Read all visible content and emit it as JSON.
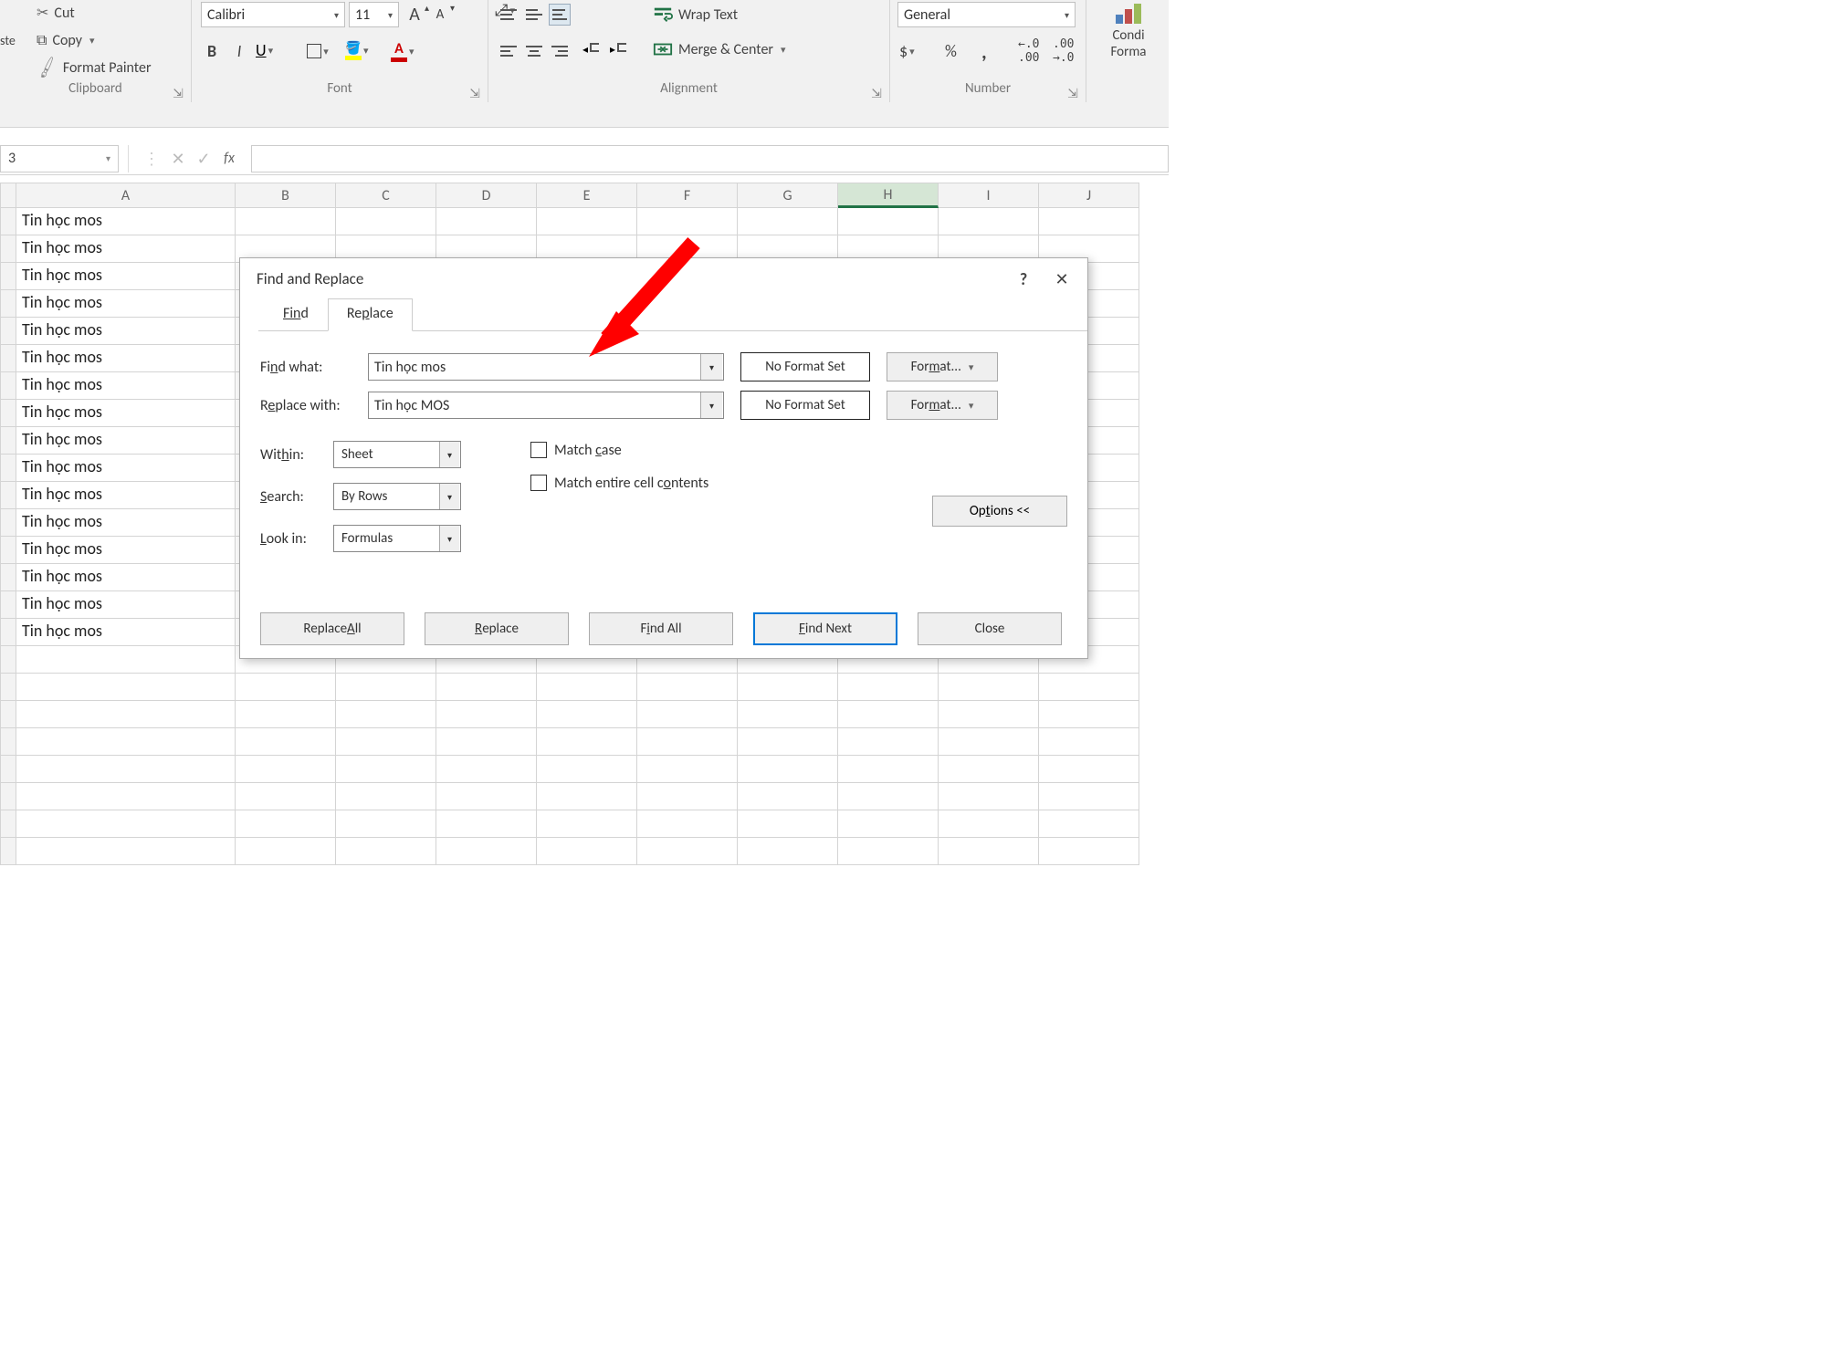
{
  "ribbon": {
    "clipboard": {
      "label": "Clipboard",
      "paste": "ste",
      "cut": "Cut",
      "copy": "Copy",
      "format_painter": "Format Painter"
    },
    "font": {
      "label": "Font",
      "name": "Calibri",
      "size": "11",
      "bold": "B",
      "italic": "I",
      "underline": "U",
      "increase_font": "A",
      "decrease_font": "A",
      "fill_letter": "A",
      "color_letter": "A"
    },
    "alignment": {
      "label": "Alignment",
      "wrap": "Wrap Text",
      "merge": "Merge & Center"
    },
    "number": {
      "label": "Number",
      "format": "General",
      "accounting": "$",
      "percent": "%",
      "comma": ",",
      "inc_dec": "←.0\n.00",
      "dec_dec": ".00\n→.0"
    },
    "cond": {
      "label1": "Condi",
      "label2": "Forma"
    }
  },
  "formula_bar": {
    "name_box": "3",
    "fx": "fx"
  },
  "columns": [
    "A",
    "B",
    "C",
    "D",
    "E",
    "F",
    "G",
    "H",
    "I",
    "J"
  ],
  "active_column_index": 7,
  "cell_value": "Tin học mos",
  "data_rows": 16,
  "dialog": {
    "title": "Find and Replace",
    "tab_find": "Find",
    "tab_replace": "Replace",
    "find_what_label": "Find what:",
    "find_what_value": "Tin học mos",
    "replace_with_label": "Replace with:",
    "replace_with_value": "Tin học MOS",
    "no_format": "No Format Set",
    "format_btn": "Format...",
    "within_label": "Within:",
    "within_value": "Sheet",
    "search_label": "Search:",
    "search_value": "By Rows",
    "lookin_label": "Look in:",
    "lookin_value": "Formulas",
    "match_case": "Match case",
    "match_entire": "Match entire cell contents",
    "options_btn": "Options <<",
    "replace_all": "Replace All",
    "replace": "Replace",
    "find_all": "Find All",
    "find_next": "Find Next",
    "close": "Close"
  }
}
